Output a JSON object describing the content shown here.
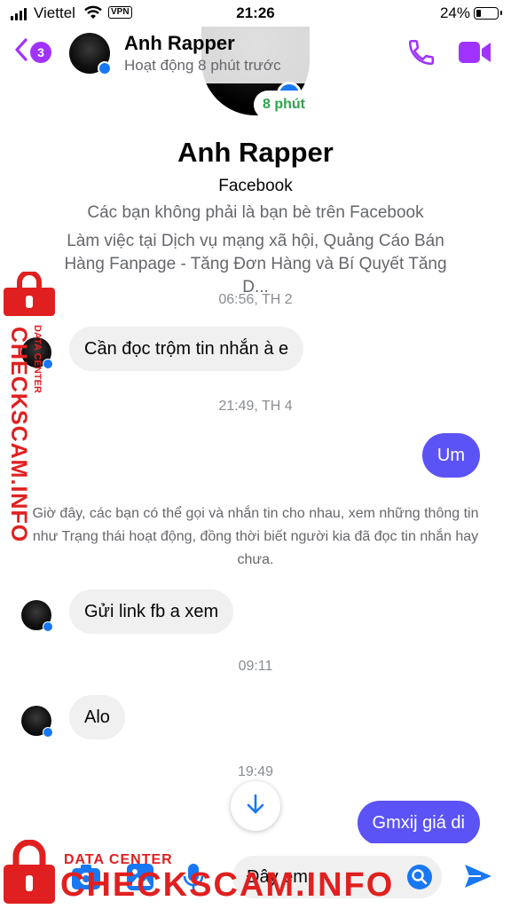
{
  "status_bar": {
    "carrier": "Viettel",
    "vpn_label": "VPN",
    "time": "21:26",
    "battery_percent": "24%",
    "battery_level": 0.24
  },
  "header": {
    "unread_count": "3",
    "contact_name": "Anh Rapper",
    "contact_status": "Hoạt động 8 phút trước"
  },
  "profile": {
    "active_badge": "8 phút",
    "name": "Anh Rapper",
    "subtitle": "Facebook",
    "friend_status": "Các bạn không phải là bạn bè trên Facebook",
    "work": "Làm việc tại Dịch vụ mạng xã hội, Quảng Cáo Bán Hàng Fanpage - Tăng Đơn Hàng và Bí Quyết Tăng D..."
  },
  "conversation": {
    "timestamps": [
      "06:56, TH 2",
      "21:49, TH 4",
      "09:11",
      "19:49"
    ],
    "messages": [
      {
        "direction": "incoming",
        "text": "Cần đọc trộm tin nhắn à e"
      },
      {
        "direction": "outgoing",
        "text": "Um"
      },
      {
        "direction": "incoming",
        "text": "Gửi link fb a xem"
      },
      {
        "direction": "incoming",
        "text": "Alo"
      },
      {
        "direction": "outgoing",
        "text": "Gmxij giá di"
      }
    ],
    "system_note": "Giờ đây, các bạn có thể gọi và nhắn tin cho nhau, xem những thông tin như Trạng thái hoạt động, đồng thời biết người kia đã đọc tin nhắn hay chưa."
  },
  "composer": {
    "input_value": "Đây em"
  },
  "watermark": {
    "brand": "CHECKSCAM.INFO",
    "tag": "DATA CENTER"
  },
  "colors": {
    "accent": "#a033ff",
    "outgoing_bubble": "#5b53f5",
    "incoming_bubble": "#f0f0f0",
    "active_green": "#31a24c",
    "watermark_red": "#e02020"
  }
}
